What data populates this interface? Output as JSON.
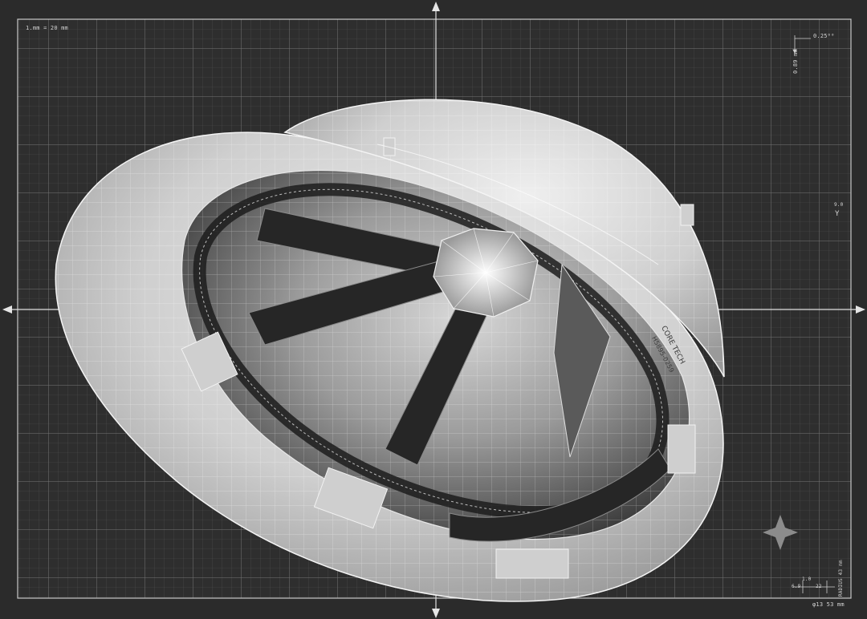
{
  "scale_label": "1.mm = 20 mm",
  "dimension_top": "0.25⁰⁰",
  "dimension_vertical": "0.89 mm",
  "axis_marker": "Y",
  "axis_marker_small": "9.0",
  "bottom_dims": {
    "left": "6.9",
    "right": "22",
    "small": "1.0",
    "vertical": "RADIUS 43 mm",
    "footer": "φ13 53 mm"
  },
  "helmet_branding": {
    "line1": "CORE TECH",
    "line2": "H5895-0259"
  },
  "colors": {
    "background": "#2b2b2b",
    "grid_minor": "#4a4a4a",
    "grid_major": "#7a7a7a",
    "helmet": "#d9d9d9",
    "wireframe": "#ffffff"
  }
}
